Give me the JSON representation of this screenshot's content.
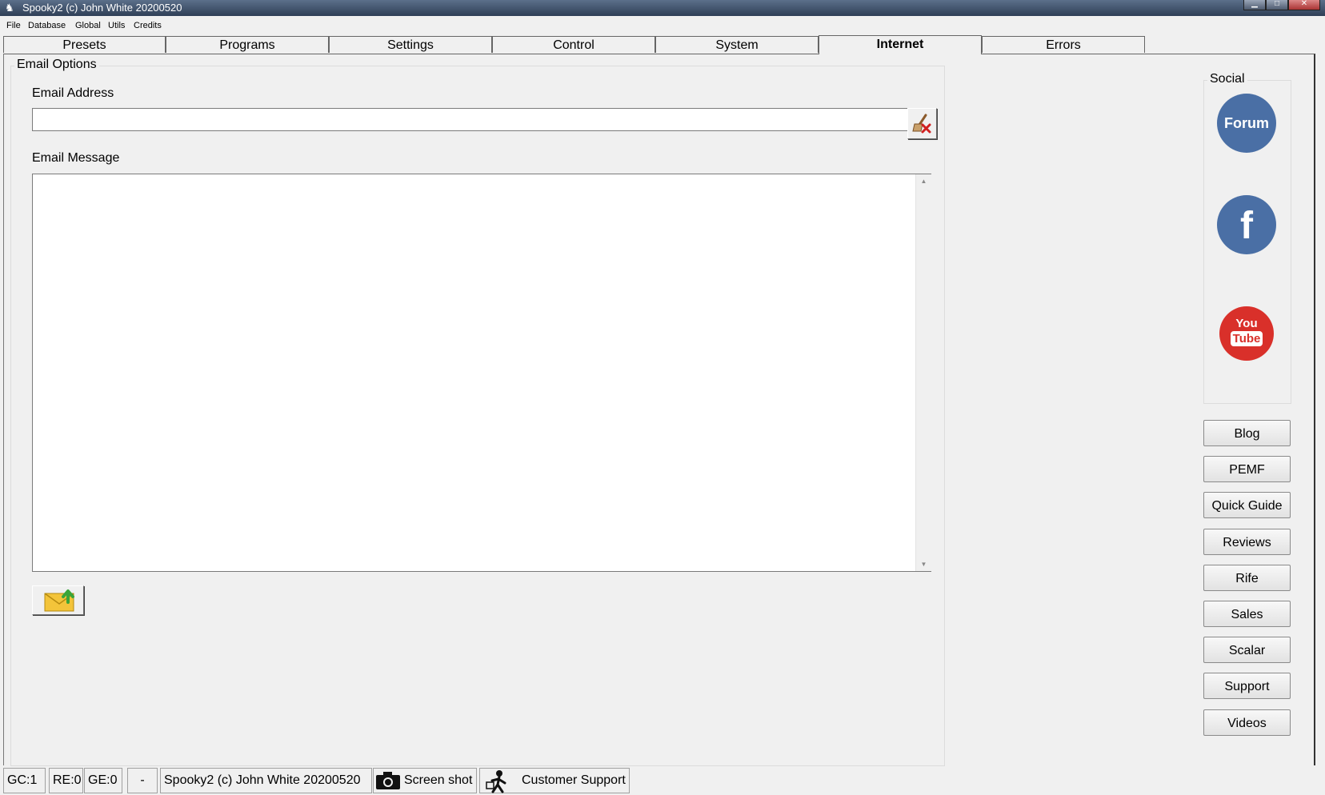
{
  "window": {
    "title": "Spooky2 (c) John White 20200520"
  },
  "menu": [
    "File",
    "Database",
    "Global",
    "Utils",
    "Credits"
  ],
  "tabs": [
    "Presets",
    "Programs",
    "Settings",
    "Control",
    "System",
    "Internet",
    "Errors"
  ],
  "active_tab": "Internet",
  "email": {
    "group_title": "Email Options",
    "address_label": "Email Address",
    "address_value": "",
    "message_label": "Email Message",
    "message_value": ""
  },
  "social": {
    "group_title": "Social",
    "forum_label": "Forum",
    "facebook_label": "f",
    "youtube_label_top": "You",
    "youtube_label_bottom": "Tube"
  },
  "link_buttons": [
    "Blog",
    "PEMF",
    "Quick Guide",
    "Reviews",
    "Rife",
    "Sales",
    "Scalar",
    "Support",
    "Videos"
  ],
  "status": {
    "gc": "GC:1",
    "re": "RE:0",
    "ge": "GE:0",
    "dash": "-",
    "info": "Spooky2 (c) John White 20200520",
    "screenshot": "Screen shot",
    "support": "Customer Support"
  },
  "colors": {
    "forum": "#4a6fa5",
    "facebook": "#4a6fa5",
    "youtube": "#d9302a"
  }
}
